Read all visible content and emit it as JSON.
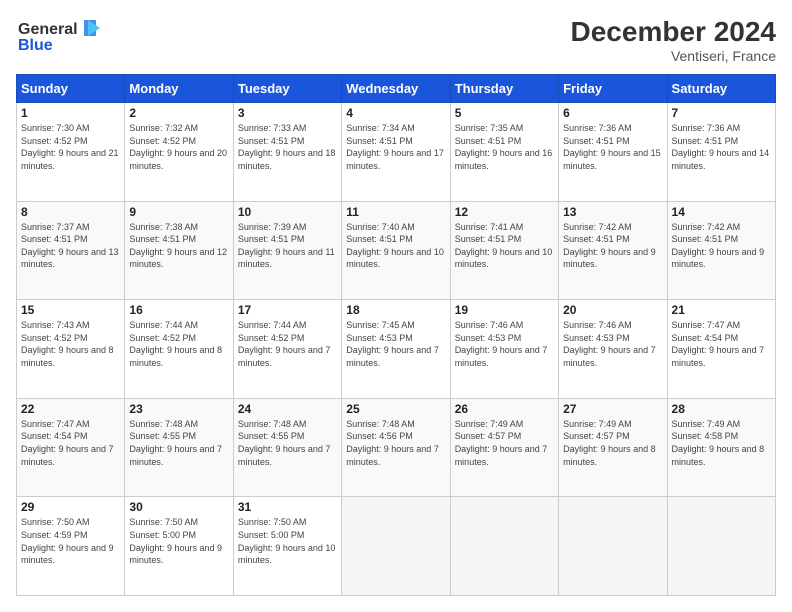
{
  "header": {
    "logo_line1": "General",
    "logo_line2": "Blue",
    "month_title": "December 2024",
    "location": "Ventiseri, France"
  },
  "weekdays": [
    "Sunday",
    "Monday",
    "Tuesday",
    "Wednesday",
    "Thursday",
    "Friday",
    "Saturday"
  ],
  "weeks": [
    [
      {
        "day": "1",
        "sunrise": "7:30 AM",
        "sunset": "4:52 PM",
        "daylight": "9 hours and 21 minutes."
      },
      {
        "day": "2",
        "sunrise": "7:32 AM",
        "sunset": "4:52 PM",
        "daylight": "9 hours and 20 minutes."
      },
      {
        "day": "3",
        "sunrise": "7:33 AM",
        "sunset": "4:51 PM",
        "daylight": "9 hours and 18 minutes."
      },
      {
        "day": "4",
        "sunrise": "7:34 AM",
        "sunset": "4:51 PM",
        "daylight": "9 hours and 17 minutes."
      },
      {
        "day": "5",
        "sunrise": "7:35 AM",
        "sunset": "4:51 PM",
        "daylight": "9 hours and 16 minutes."
      },
      {
        "day": "6",
        "sunrise": "7:36 AM",
        "sunset": "4:51 PM",
        "daylight": "9 hours and 15 minutes."
      },
      {
        "day": "7",
        "sunrise": "7:36 AM",
        "sunset": "4:51 PM",
        "daylight": "9 hours and 14 minutes."
      }
    ],
    [
      {
        "day": "8",
        "sunrise": "7:37 AM",
        "sunset": "4:51 PM",
        "daylight": "9 hours and 13 minutes."
      },
      {
        "day": "9",
        "sunrise": "7:38 AM",
        "sunset": "4:51 PM",
        "daylight": "9 hours and 12 minutes."
      },
      {
        "day": "10",
        "sunrise": "7:39 AM",
        "sunset": "4:51 PM",
        "daylight": "9 hours and 11 minutes."
      },
      {
        "day": "11",
        "sunrise": "7:40 AM",
        "sunset": "4:51 PM",
        "daylight": "9 hours and 10 minutes."
      },
      {
        "day": "12",
        "sunrise": "7:41 AM",
        "sunset": "4:51 PM",
        "daylight": "9 hours and 10 minutes."
      },
      {
        "day": "13",
        "sunrise": "7:42 AM",
        "sunset": "4:51 PM",
        "daylight": "9 hours and 9 minutes."
      },
      {
        "day": "14",
        "sunrise": "7:42 AM",
        "sunset": "4:51 PM",
        "daylight": "9 hours and 9 minutes."
      }
    ],
    [
      {
        "day": "15",
        "sunrise": "7:43 AM",
        "sunset": "4:52 PM",
        "daylight": "9 hours and 8 minutes."
      },
      {
        "day": "16",
        "sunrise": "7:44 AM",
        "sunset": "4:52 PM",
        "daylight": "9 hours and 8 minutes."
      },
      {
        "day": "17",
        "sunrise": "7:44 AM",
        "sunset": "4:52 PM",
        "daylight": "9 hours and 7 minutes."
      },
      {
        "day": "18",
        "sunrise": "7:45 AM",
        "sunset": "4:53 PM",
        "daylight": "9 hours and 7 minutes."
      },
      {
        "day": "19",
        "sunrise": "7:46 AM",
        "sunset": "4:53 PM",
        "daylight": "9 hours and 7 minutes."
      },
      {
        "day": "20",
        "sunrise": "7:46 AM",
        "sunset": "4:53 PM",
        "daylight": "9 hours and 7 minutes."
      },
      {
        "day": "21",
        "sunrise": "7:47 AM",
        "sunset": "4:54 PM",
        "daylight": "9 hours and 7 minutes."
      }
    ],
    [
      {
        "day": "22",
        "sunrise": "7:47 AM",
        "sunset": "4:54 PM",
        "daylight": "9 hours and 7 minutes."
      },
      {
        "day": "23",
        "sunrise": "7:48 AM",
        "sunset": "4:55 PM",
        "daylight": "9 hours and 7 minutes."
      },
      {
        "day": "24",
        "sunrise": "7:48 AM",
        "sunset": "4:55 PM",
        "daylight": "9 hours and 7 minutes."
      },
      {
        "day": "25",
        "sunrise": "7:48 AM",
        "sunset": "4:56 PM",
        "daylight": "9 hours and 7 minutes."
      },
      {
        "day": "26",
        "sunrise": "7:49 AM",
        "sunset": "4:57 PM",
        "daylight": "9 hours and 7 minutes."
      },
      {
        "day": "27",
        "sunrise": "7:49 AM",
        "sunset": "4:57 PM",
        "daylight": "9 hours and 8 minutes."
      },
      {
        "day": "28",
        "sunrise": "7:49 AM",
        "sunset": "4:58 PM",
        "daylight": "9 hours and 8 minutes."
      }
    ],
    [
      {
        "day": "29",
        "sunrise": "7:50 AM",
        "sunset": "4:59 PM",
        "daylight": "9 hours and 9 minutes."
      },
      {
        "day": "30",
        "sunrise": "7:50 AM",
        "sunset": "5:00 PM",
        "daylight": "9 hours and 9 minutes."
      },
      {
        "day": "31",
        "sunrise": "7:50 AM",
        "sunset": "5:00 PM",
        "daylight": "9 hours and 10 minutes."
      },
      null,
      null,
      null,
      null
    ]
  ]
}
